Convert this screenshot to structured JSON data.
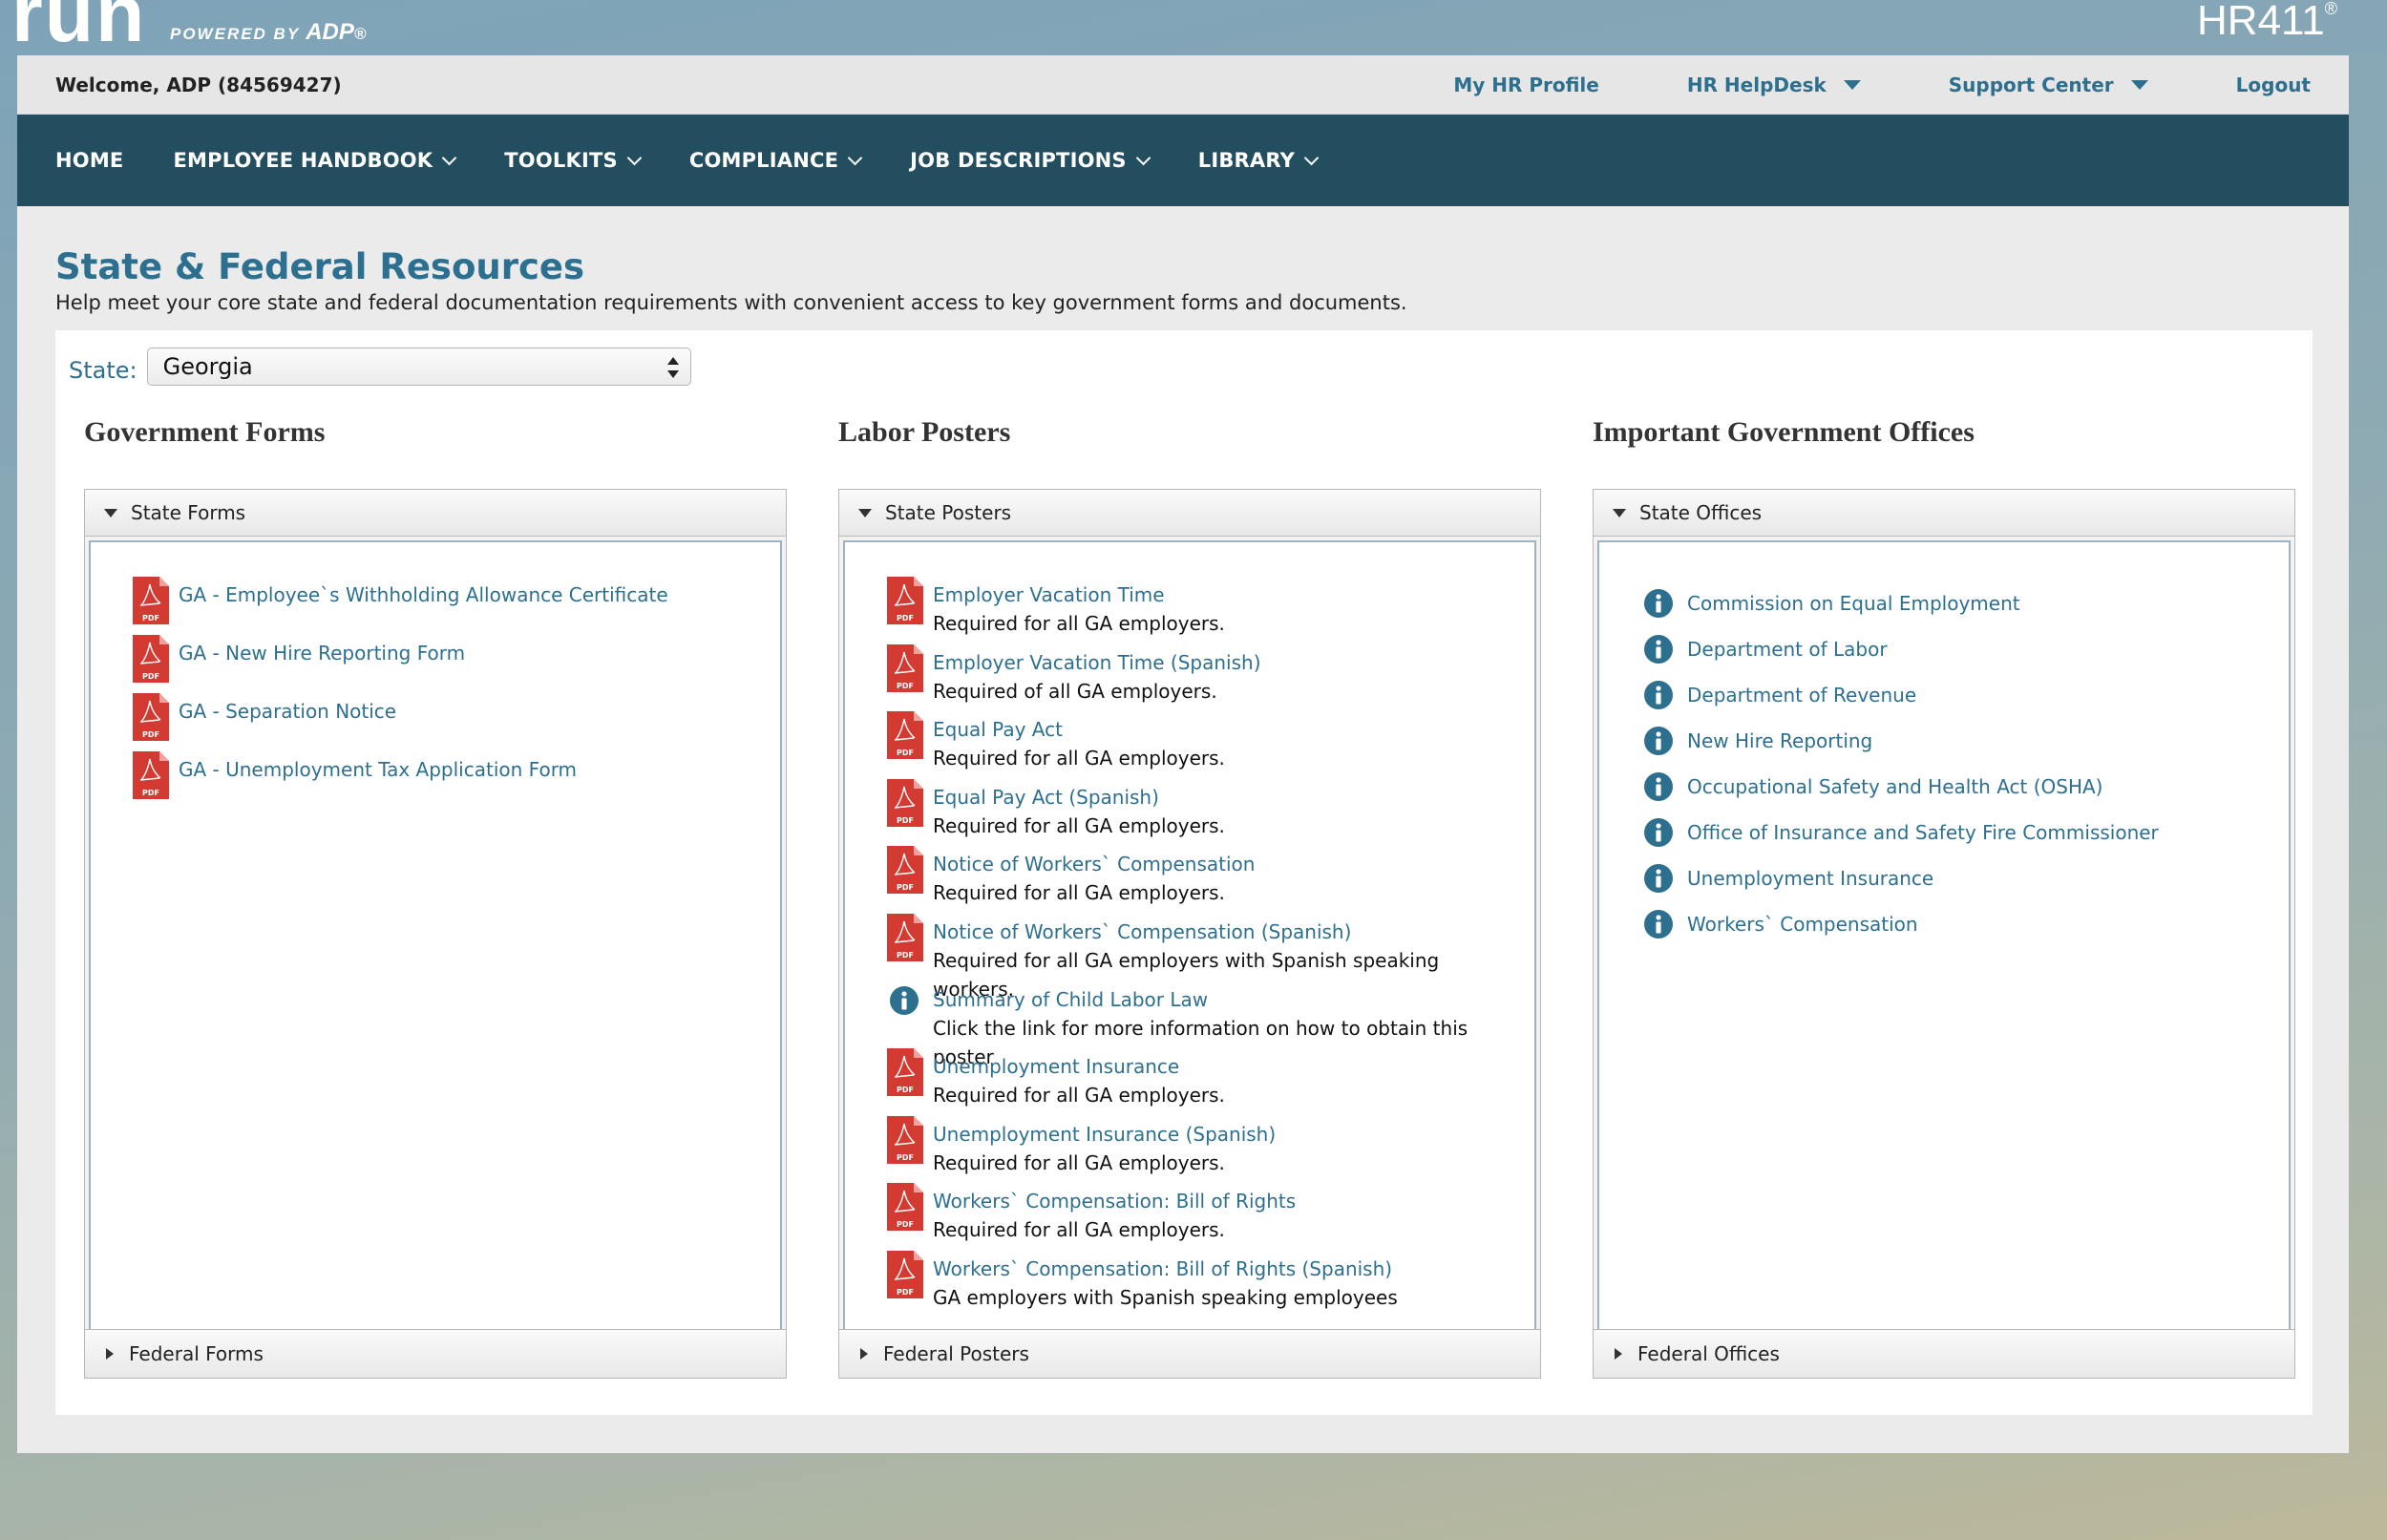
{
  "branding": {
    "logo_text": "run",
    "powered_by": "POWERED BY",
    "powered_brand": "ADP",
    "product": "HR411"
  },
  "topbar": {
    "welcome": "Welcome, ADP (84569427)",
    "links": [
      "My HR Profile",
      "HR HelpDesk",
      "Support Center",
      "Logout"
    ]
  },
  "nav": {
    "items": [
      "HOME",
      "EMPLOYEE HANDBOOK",
      "TOOLKITS",
      "COMPLIANCE",
      "JOB DESCRIPTIONS",
      "LIBRARY"
    ]
  },
  "page": {
    "title": "State & Federal Resources",
    "subtitle": "Help meet your core state and federal documentation requirements with convenient access to key government forms and documents."
  },
  "state_select": {
    "label": "State:",
    "value": "Georgia"
  },
  "government_forms": {
    "title": "Government Forms",
    "state_header": "State Forms",
    "federal_header": "Federal Forms",
    "items": [
      {
        "icon": "pdf-icon",
        "label": "GA - Employee`s Withholding Allowance Certificate"
      },
      {
        "icon": "pdf-icon",
        "label": "GA - New Hire Reporting Form"
      },
      {
        "icon": "pdf-icon",
        "label": "GA - Separation Notice"
      },
      {
        "icon": "pdf-icon",
        "label": "GA - Unemployment Tax Application Form"
      }
    ]
  },
  "labor_posters": {
    "title": "Labor Posters",
    "state_header": "State Posters",
    "federal_header": "Federal Posters",
    "items": [
      {
        "icon": "pdf-icon",
        "label": "Employer Vacation Time",
        "desc": "Required for all GA employers."
      },
      {
        "icon": "pdf-icon",
        "label": "Employer Vacation Time (Spanish)",
        "desc": "Required of all GA employers."
      },
      {
        "icon": "pdf-icon",
        "label": "Equal Pay Act",
        "desc": "Required for all GA employers."
      },
      {
        "icon": "pdf-icon",
        "label": "Equal Pay Act (Spanish)",
        "desc": "Required for all GA employers."
      },
      {
        "icon": "pdf-icon",
        "label": "Notice of Workers` Compensation",
        "desc": "Required for all GA employers."
      },
      {
        "icon": "pdf-icon",
        "label": "Notice of Workers` Compensation (Spanish)",
        "desc": "Required for all GA employers with Spanish speaking workers."
      },
      {
        "icon": "info-icon",
        "label": "Summary of Child Labor Law",
        "desc": "Click the link for more information on how to obtain this poster"
      },
      {
        "icon": "pdf-icon",
        "label": "Unemployment Insurance",
        "desc": "Required for all GA employers."
      },
      {
        "icon": "pdf-icon",
        "label": "Unemployment Insurance (Spanish)",
        "desc": "Required for all GA employers."
      },
      {
        "icon": "pdf-icon",
        "label": "Workers` Compensation: Bill of Rights",
        "desc": "Required for all GA employers."
      },
      {
        "icon": "pdf-icon",
        "label": "Workers` Compensation: Bill of Rights (Spanish)",
        "desc": "GA employers with Spanish speaking employees"
      }
    ]
  },
  "government_offices": {
    "title": "Important Government Offices",
    "state_header": "State Offices",
    "federal_header": "Federal Offices",
    "items": [
      {
        "icon": "info-icon",
        "label": "Commission on Equal Employment"
      },
      {
        "icon": "info-icon",
        "label": "Department of Labor"
      },
      {
        "icon": "info-icon",
        "label": "Department of Revenue"
      },
      {
        "icon": "info-icon",
        "label": "New Hire Reporting"
      },
      {
        "icon": "info-icon",
        "label": "Occupational Safety and Health Act (OSHA)"
      },
      {
        "icon": "info-icon",
        "label": "Office of Insurance and Safety Fire Commissioner"
      },
      {
        "icon": "info-icon",
        "label": "Unemployment Insurance"
      },
      {
        "icon": "info-icon",
        "label": "Workers` Compensation"
      }
    ]
  },
  "colors": {
    "nav_bg": "#234e60",
    "link": "#2d6f8f",
    "pdf_red": "#d33a32",
    "info_blue": "#2d6f8f"
  }
}
